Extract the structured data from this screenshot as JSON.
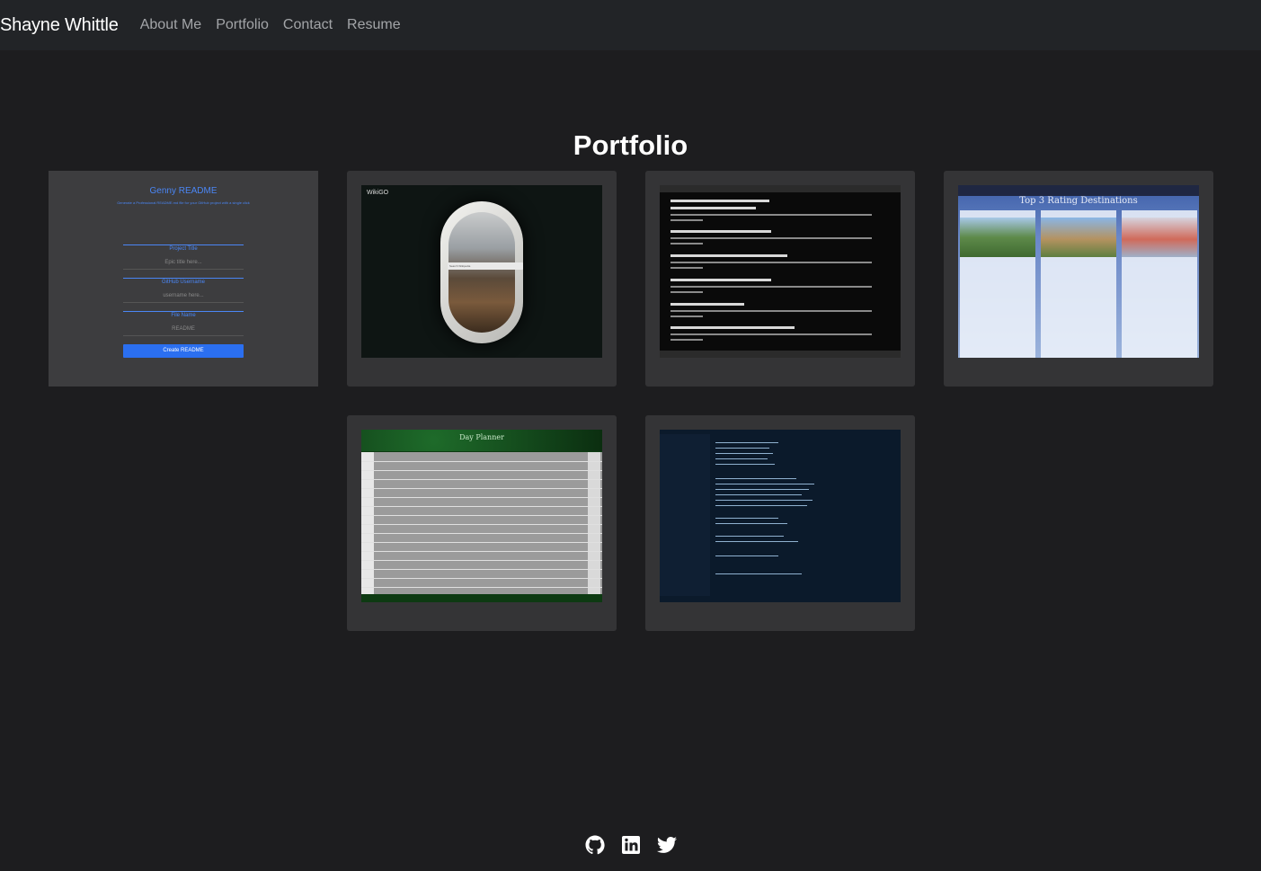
{
  "nav": {
    "brand": "Shayne Whittle",
    "links": [
      "About Me",
      "Portfolio",
      "Contact",
      "Resume"
    ]
  },
  "page_title": "Portfolio",
  "projects": {
    "readme": {
      "title": "Genny README",
      "subtitle": "Generate a Professional README.md file for your GitHub project with a single click",
      "project_label": "Project Title",
      "project_placeholder": "Epic title here...",
      "github_label": "GitHub Username",
      "github_placeholder": "username here...",
      "file_label": "File Name",
      "file_placeholder": "README",
      "button": "Create README"
    },
    "wiki": {
      "logo": "WikiGO",
      "search": "Search Wikipedia"
    },
    "forum": {},
    "travel": {
      "heading": "Top 3 Rating Destinations"
    },
    "planner": {
      "title": "Day Planner"
    },
    "terminal": {}
  },
  "footer": {
    "icons": [
      "github-icon",
      "linkedin-icon",
      "twitter-icon"
    ]
  },
  "colors": {
    "background": "#1d1d1f",
    "navbar": "#222427",
    "card": "#343436",
    "accent": "#2b6ff0"
  }
}
